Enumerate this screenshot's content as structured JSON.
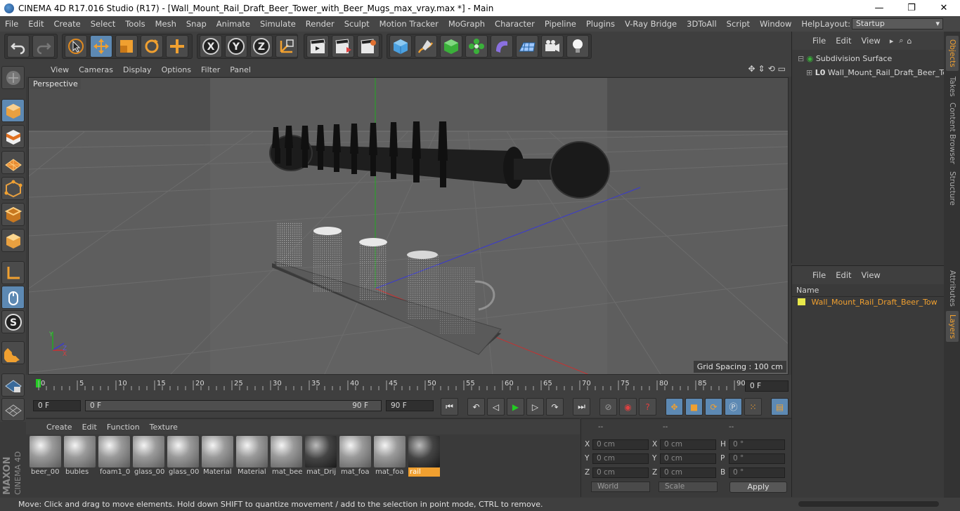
{
  "titlebar": {
    "title": "CINEMA 4D R17.016 Studio (R17) - [Wall_Mount_Rail_Draft_Beer_Tower_with_Beer_Mugs_max_vray.max *] - Main",
    "minimize": "—",
    "maximize": "❐",
    "close": "✕"
  },
  "menubar": {
    "items": [
      "File",
      "Edit",
      "Create",
      "Select",
      "Tools",
      "Mesh",
      "Snap",
      "Animate",
      "Simulate",
      "Render",
      "Sculpt",
      "Motion Tracker",
      "MoGraph",
      "Character",
      "Pipeline",
      "Plugins",
      "V-Ray Bridge",
      "3DToAll",
      "Script",
      "Window",
      "Help"
    ],
    "layout_label": "Layout:",
    "layout_value": "Startup"
  },
  "toolbar": {
    "axis_x": "X",
    "axis_y": "Y",
    "axis_z": "Z"
  },
  "viewport": {
    "menu": [
      "View",
      "Cameras",
      "Display",
      "Options",
      "Filter",
      "Panel"
    ],
    "camera_label": "Perspective",
    "grid_spacing": "Grid Spacing : 100 cm",
    "nav_icons": [
      "✥",
      "⇕",
      "⟲",
      "▭"
    ]
  },
  "timeline": {
    "ticks": [
      "0",
      "5",
      "10",
      "15",
      "20",
      "25",
      "30",
      "35",
      "40",
      "45",
      "50",
      "55",
      "60",
      "65",
      "70",
      "75",
      "80",
      "85",
      "90"
    ],
    "current_frame": "0 F"
  },
  "playbar": {
    "start": "0 F",
    "range_start": "0 F",
    "range_end": "90 F",
    "end": "90 F"
  },
  "materials": {
    "menu": [
      "Create",
      "Edit",
      "Function",
      "Texture"
    ],
    "items": [
      {
        "name": "beer_00"
      },
      {
        "name": "bubles"
      },
      {
        "name": "foam1_0"
      },
      {
        "name": "glass_00"
      },
      {
        "name": "glass_00"
      },
      {
        "name": "Material"
      },
      {
        "name": "Material"
      },
      {
        "name": "mat_bee"
      },
      {
        "name": "mat_Drij"
      },
      {
        "name": "mat_foa"
      },
      {
        "name": "mat_foa"
      },
      {
        "name": "rail",
        "selected": true
      }
    ]
  },
  "coords": {
    "head1": "--",
    "head2": "--",
    "head3": "--",
    "pos_x": "0 cm",
    "pos_y": "0 cm",
    "pos_z": "0 cm",
    "size_x": "0 cm",
    "size_y": "0 cm",
    "size_z": "0 cm",
    "rot_h": "0 °",
    "rot_p": "0 °",
    "rot_b": "0 °",
    "world": "World",
    "scale": "Scale",
    "apply": "Apply"
  },
  "statusbar": {
    "text": "Move: Click and drag to move elements. Hold down SHIFT to quantize movement / add to the selection in point mode, CTRL to remove."
  },
  "objects_panel": {
    "menu": [
      "File",
      "Edit",
      "View"
    ],
    "tree": [
      {
        "label": "Subdivision Surface"
      },
      {
        "label": "Wall_Mount_Rail_Draft_Beer_Tow"
      }
    ]
  },
  "layers_panel": {
    "menu": [
      "File",
      "Edit",
      "View"
    ],
    "column": "Name",
    "layer": "Wall_Mount_Rail_Draft_Beer_Tow",
    "layer_color": "#e8e84a"
  },
  "side_tabs": {
    "top": [
      "Objects",
      "Takes",
      "Content Browser",
      "Structure"
    ],
    "bottom": [
      "Attributes",
      "Layers"
    ]
  },
  "colors": {
    "accent": "#f0a030",
    "active_blue": "#5d89b3",
    "axis_green": "#22aa22",
    "axis_blue": "#3a3ad0",
    "axis_red": "#c83030"
  }
}
